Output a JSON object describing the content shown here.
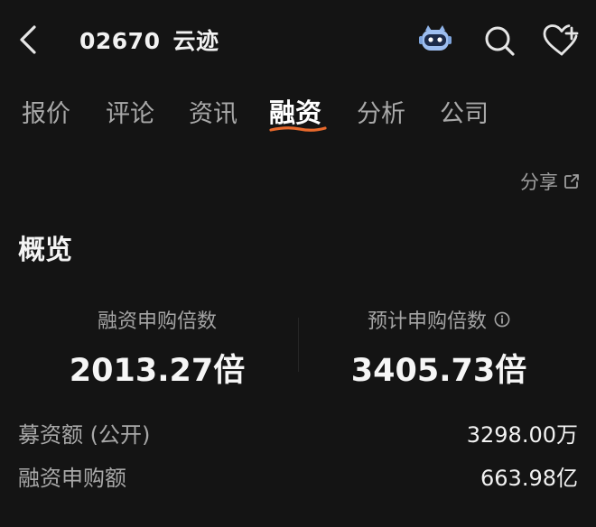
{
  "header": {
    "stock_code": "02670",
    "stock_name": "云迹"
  },
  "icons": {
    "back": "chevron-left-icon",
    "assistant": "robot-icon",
    "search": "search-icon",
    "favorite": "heart-plus-icon",
    "share": "external-link-icon",
    "info": "info-icon"
  },
  "tabs": [
    {
      "label": "报价"
    },
    {
      "label": "评论"
    },
    {
      "label": "资讯"
    },
    {
      "label": "融资",
      "active": true
    },
    {
      "label": "分析"
    },
    {
      "label": "公司"
    }
  ],
  "share": {
    "label": "分享"
  },
  "overview": {
    "title": "概览",
    "metrics": [
      {
        "label": "融资申购倍数",
        "value": "2013.27倍"
      },
      {
        "label": "预计申购倍数",
        "value": "3405.73倍"
      }
    ],
    "rows": [
      {
        "label": "募资额 (公开)",
        "value": "3298.00万"
      },
      {
        "label": "融资申购额",
        "value": "663.98亿"
      }
    ]
  },
  "colors": {
    "background": "#141414",
    "accent": "#e8692c"
  }
}
